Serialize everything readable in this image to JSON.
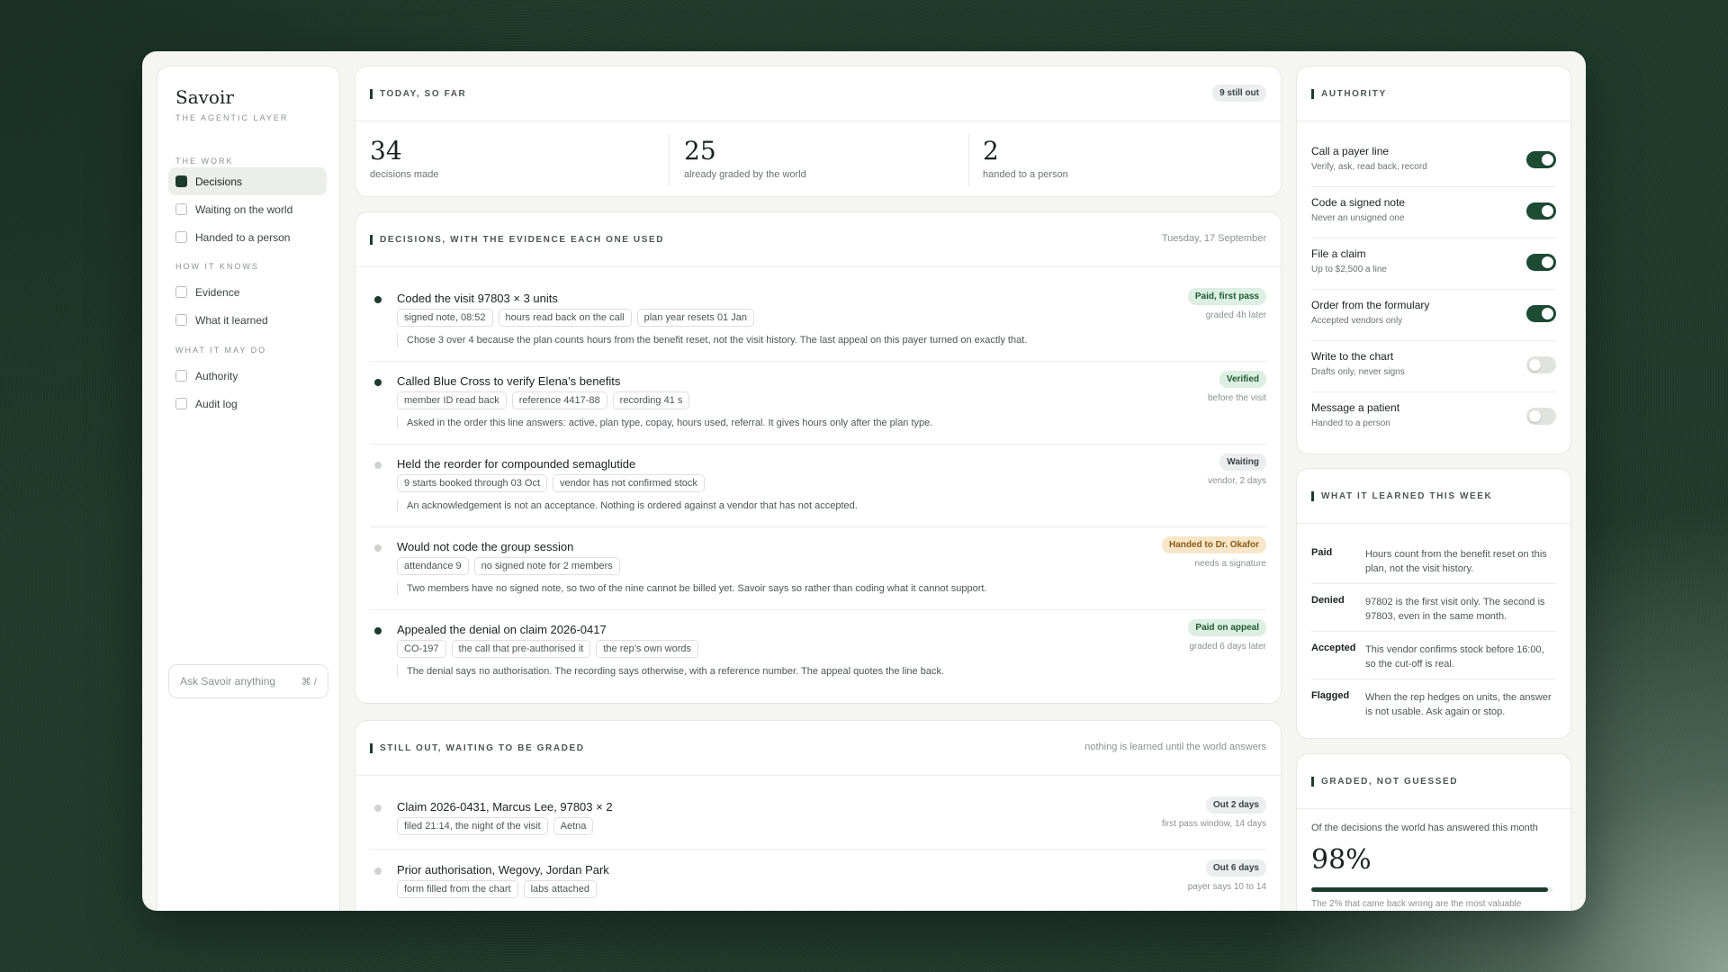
{
  "brand": {
    "name": "Savoir",
    "tagline": "THE AGENTIC LAYER"
  },
  "nav": {
    "sections": [
      {
        "label": "THE WORK",
        "items": [
          "Decisions",
          "Waiting on the world",
          "Handed to a person"
        ]
      },
      {
        "label": "HOW IT KNOWS",
        "items": [
          "Evidence",
          "What it learned"
        ]
      },
      {
        "label": "WHAT IT MAY DO",
        "items": [
          "Authority",
          "Audit log"
        ]
      }
    ],
    "active": "Decisions",
    "ask_placeholder": "Ask Savoir anything",
    "ask_shortcut": "⌘ /"
  },
  "today": {
    "title": "TODAY, SO FAR",
    "badge": "9 still out",
    "stats": [
      {
        "value": "34",
        "label": "decisions made"
      },
      {
        "value": "25",
        "label": "already graded by the world"
      },
      {
        "value": "2",
        "label": "handed to a person"
      }
    ]
  },
  "decisions": {
    "title": "DECISIONS, WITH THE EVIDENCE EACH ONE USED",
    "date": "Tuesday, 17 September",
    "rows": [
      {
        "title": "Coded the visit 97803 × 3 units",
        "tags": [
          "signed note, 08:52",
          "hours read back on the call",
          "plan year resets 01 Jan"
        ],
        "note": "Chose 3 over 4 because the plan counts hours from the benefit reset, not the visit history. The last appeal on this payer turned on exactly that.",
        "status": "Paid, first pass",
        "when": "graded 4h later"
      },
      {
        "title": "Called Blue Cross to verify Elena’s benefits",
        "tags": [
          "member ID read back",
          "reference 4417-88",
          "recording 41 s"
        ],
        "note": "Asked in the order this line answers: active, plan type, copay, hours used, referral. It gives hours only after the plan type.",
        "status": "Verified",
        "when": "before the visit"
      },
      {
        "title": "Held the reorder for compounded semaglutide",
        "tags": [
          "9 starts booked through 03 Oct",
          "vendor has not confirmed stock"
        ],
        "note": "An acknowledgement is not an acceptance. Nothing is ordered against a vendor that has not accepted.",
        "status": "Waiting",
        "when": "vendor, 2 days"
      },
      {
        "title": "Would not code the group session",
        "tags": [
          "attendance 9",
          "no signed note for 2 members"
        ],
        "note": "Two members have no signed note, so two of the nine cannot be billed yet. Savoir says so rather than coding what it cannot support.",
        "status": "Handed to Dr. Okafor",
        "when": "needs a signature"
      },
      {
        "title": "Appealed the denial on claim 2026-0417",
        "tags": [
          "CO-197",
          "the call that pre-authorised it",
          "the rep’s own words"
        ],
        "note": "The denial says no authorisation. The recording says otherwise, with a reference number. The appeal quotes the line back.",
        "status": "Paid on appeal",
        "when": "graded 6 days later"
      }
    ]
  },
  "pending": {
    "title": "STILL OUT, WAITING TO BE GRADED",
    "subtitle": "nothing is learned until the world answers",
    "rows": [
      {
        "title": "Claim 2026-0431, Marcus Lee, 97803 × 2",
        "tags": [
          "filed 21:14, the night of the visit",
          "Aetna"
        ],
        "status": "Out 2 days",
        "when": "first pass window, 14 days"
      },
      {
        "title": "Prior authorisation, Wegovy, Jordan Park",
        "tags": [
          "form filled from the chart",
          "labs attached"
        ],
        "status": "Out 6 days",
        "when": "payer says 10 to 14"
      }
    ]
  },
  "authority": {
    "title": "AUTHORITY",
    "items": [
      {
        "title": "Call a payer line",
        "sub": "Verify, ask, read back, record",
        "on": true
      },
      {
        "title": "Code a signed note",
        "sub": "Never an unsigned one",
        "on": true
      },
      {
        "title": "File a claim",
        "sub": "Up to $2,500 a line",
        "on": true
      },
      {
        "title": "Order from the formulary",
        "sub": "Accepted vendors only",
        "on": true
      },
      {
        "title": "Write to the chart",
        "sub": "Drafts only, never signs",
        "on": false
      },
      {
        "title": "Message a patient",
        "sub": "Handed to a person",
        "on": false
      }
    ]
  },
  "learned": {
    "title": "WHAT IT LEARNED THIS WEEK",
    "items": [
      {
        "key": "Paid",
        "text": "Hours count from the benefit reset on this plan, not the visit history."
      },
      {
        "key": "Denied",
        "text": "97802 is the first visit only. The second is 97803, even in the same month."
      },
      {
        "key": "Accepted",
        "text": "This vendor confirms stock before 16:00, so the cut-off is real."
      },
      {
        "key": "Flagged",
        "text": "When the rep hedges on units, the answer is not usable. Ask again or stop."
      }
    ]
  },
  "graded": {
    "title": "GRADED, NOT GUESSED",
    "caption": "Of the decisions the world has answered this month",
    "value": "98%",
    "fraction": 0.98,
    "footnote": "The 2% that came back wrong are the most valuable"
  },
  "colors": {
    "accent": "#1d3b2d",
    "paid": "#dcefe1",
    "handed": "#f7e6c9"
  }
}
